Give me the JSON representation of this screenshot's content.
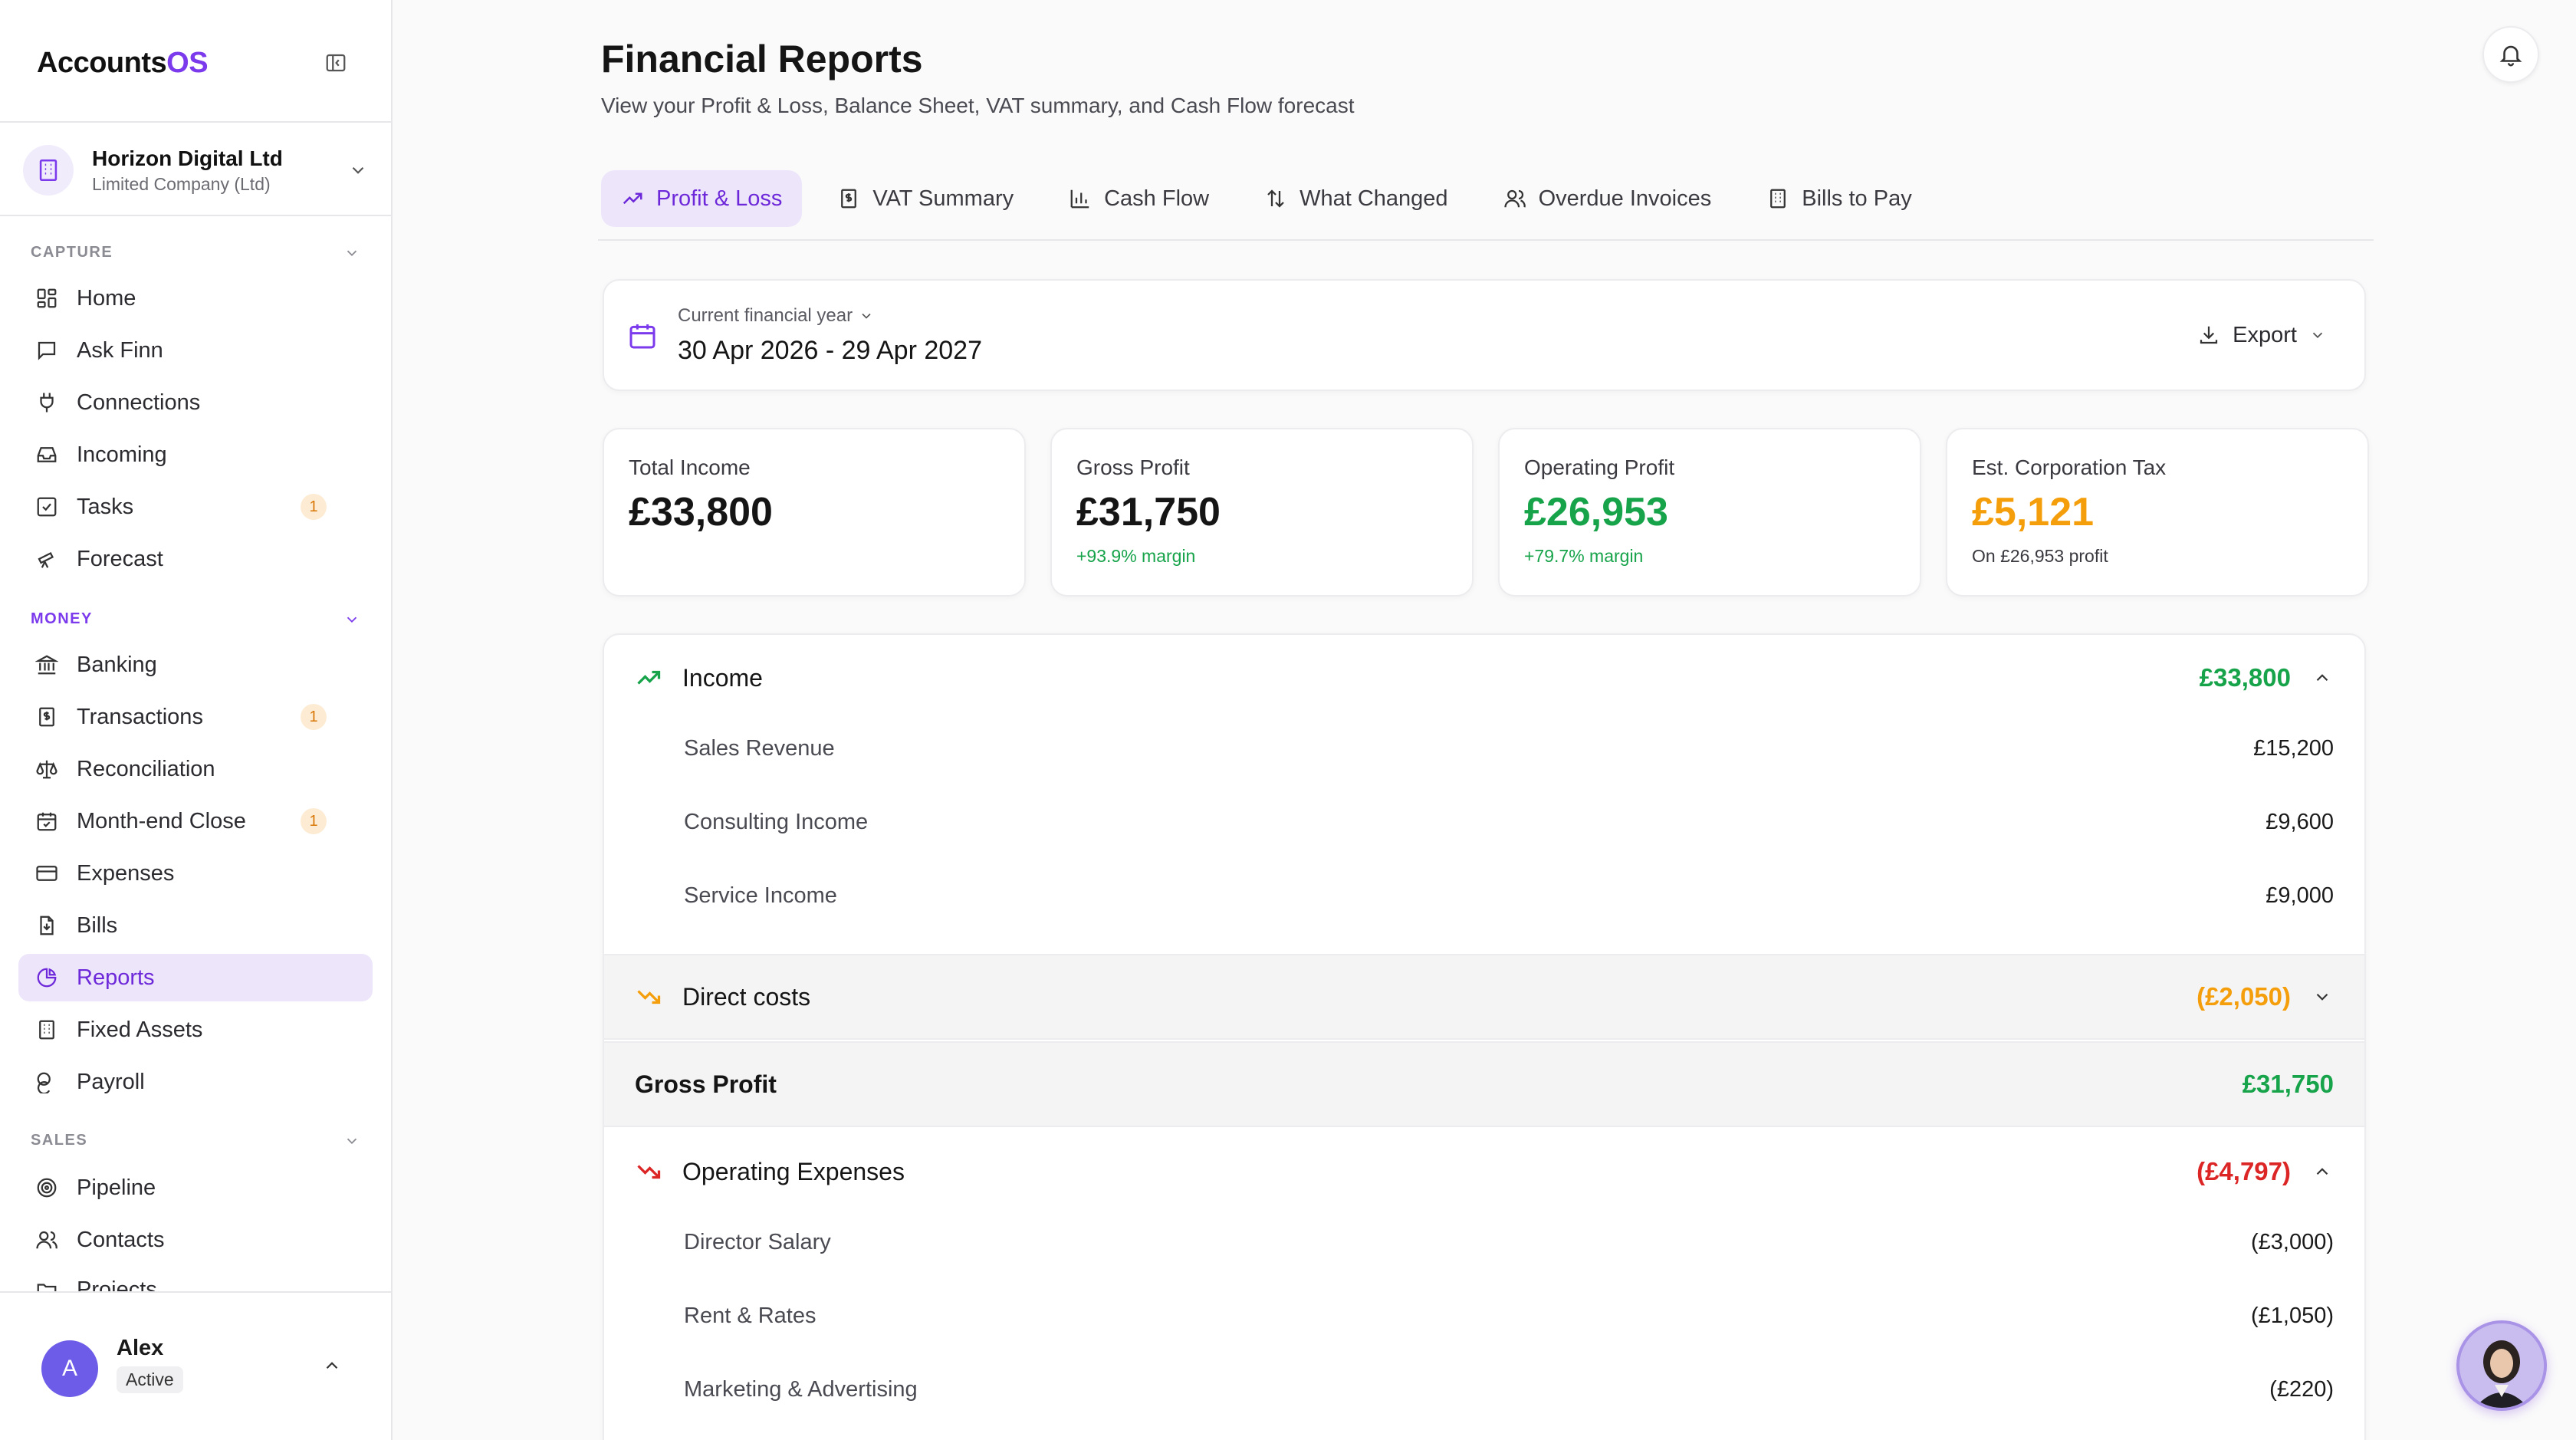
{
  "sidebar": {
    "logo_main": "Accounts",
    "logo_accent": "OS",
    "company": {
      "name": "Horizon Digital Ltd",
      "type": "Limited Company (Ltd)"
    },
    "sections": {
      "capture": "CAPTURE",
      "money": "MONEY",
      "sales": "SALES"
    },
    "items": [
      {
        "label": "Home",
        "icon": "home-grid-icon"
      },
      {
        "label": "Ask Finn",
        "icon": "chat-icon"
      },
      {
        "label": "Connections",
        "icon": "plug-icon"
      },
      {
        "label": "Incoming",
        "icon": "inbox-icon"
      },
      {
        "label": "Tasks",
        "icon": "checkbox-icon",
        "badge": "1"
      },
      {
        "label": "Forecast",
        "icon": "telescope-icon"
      },
      {
        "label": "Banking",
        "icon": "bank-icon"
      },
      {
        "label": "Transactions",
        "icon": "receipt-icon",
        "badge": "1"
      },
      {
        "label": "Reconciliation",
        "icon": "scale-icon"
      },
      {
        "label": "Month-end Close",
        "icon": "calendar-check-icon",
        "badge": "1"
      },
      {
        "label": "Expenses",
        "icon": "card-icon"
      },
      {
        "label": "Bills",
        "icon": "bill-icon"
      },
      {
        "label": "Reports",
        "icon": "pie-chart-icon",
        "active": true
      },
      {
        "label": "Fixed Assets",
        "icon": "building-icon"
      },
      {
        "label": "Payroll",
        "icon": "coins-icon"
      },
      {
        "label": "Pipeline",
        "icon": "target-icon"
      },
      {
        "label": "Contacts",
        "icon": "users-icon"
      },
      {
        "label": "Projects",
        "icon": "folder-icon"
      }
    ],
    "user": {
      "initial": "A",
      "name": "Alex",
      "status": "Active"
    }
  },
  "header": {
    "title": "Financial Reports",
    "subtitle": "View your Profit & Loss, Balance Sheet, VAT summary, and Cash Flow forecast"
  },
  "tabs": [
    {
      "label": "Profit & Loss",
      "icon": "trend-up-icon",
      "active": true
    },
    {
      "label": "VAT Summary",
      "icon": "receipt-icon"
    },
    {
      "label": "Cash Flow",
      "icon": "bar-chart-icon"
    },
    {
      "label": "What Changed",
      "icon": "arrows-updown-icon"
    },
    {
      "label": "Overdue Invoices",
      "icon": "users-icon"
    },
    {
      "label": "Bills to Pay",
      "icon": "building-icon"
    }
  ],
  "period": {
    "label": "Current financial year",
    "value": "30 Apr 2026 - 29 Apr 2027",
    "export_label": "Export"
  },
  "stats": [
    {
      "label": "Total Income",
      "value": "£33,800",
      "sub": ""
    },
    {
      "label": "Gross Profit",
      "value": "£31,750",
      "sub": "+93.9% margin"
    },
    {
      "label": "Operating Profit",
      "value": "£26,953",
      "sub": "+79.7% margin"
    },
    {
      "label": "Est. Corporation Tax",
      "value": "£5,121",
      "sub": "On £26,953 profit"
    }
  ],
  "pl": {
    "income": {
      "label": "Income",
      "total": "£33,800",
      "lines": [
        {
          "label": "Sales Revenue",
          "amount": "£15,200"
        },
        {
          "label": "Consulting Income",
          "amount": "£9,600"
        },
        {
          "label": "Service Income",
          "amount": "£9,000"
        }
      ]
    },
    "direct_costs": {
      "label": "Direct costs",
      "total": "(£2,050)"
    },
    "gross_profit": {
      "label": "Gross Profit",
      "total": "£31,750"
    },
    "operating_expenses": {
      "label": "Operating Expenses",
      "total": "(£4,797)",
      "lines": [
        {
          "label": "Director Salary",
          "amount": "(£3,000)"
        },
        {
          "label": "Rent & Rates",
          "amount": "(£1,050)"
        },
        {
          "label": "Marketing & Advertising",
          "amount": "(£220)"
        }
      ]
    }
  },
  "colors": {
    "accent": "#7c3aed",
    "positive": "#16a34a",
    "warning": "#f59e0b",
    "negative": "#dc2626"
  }
}
